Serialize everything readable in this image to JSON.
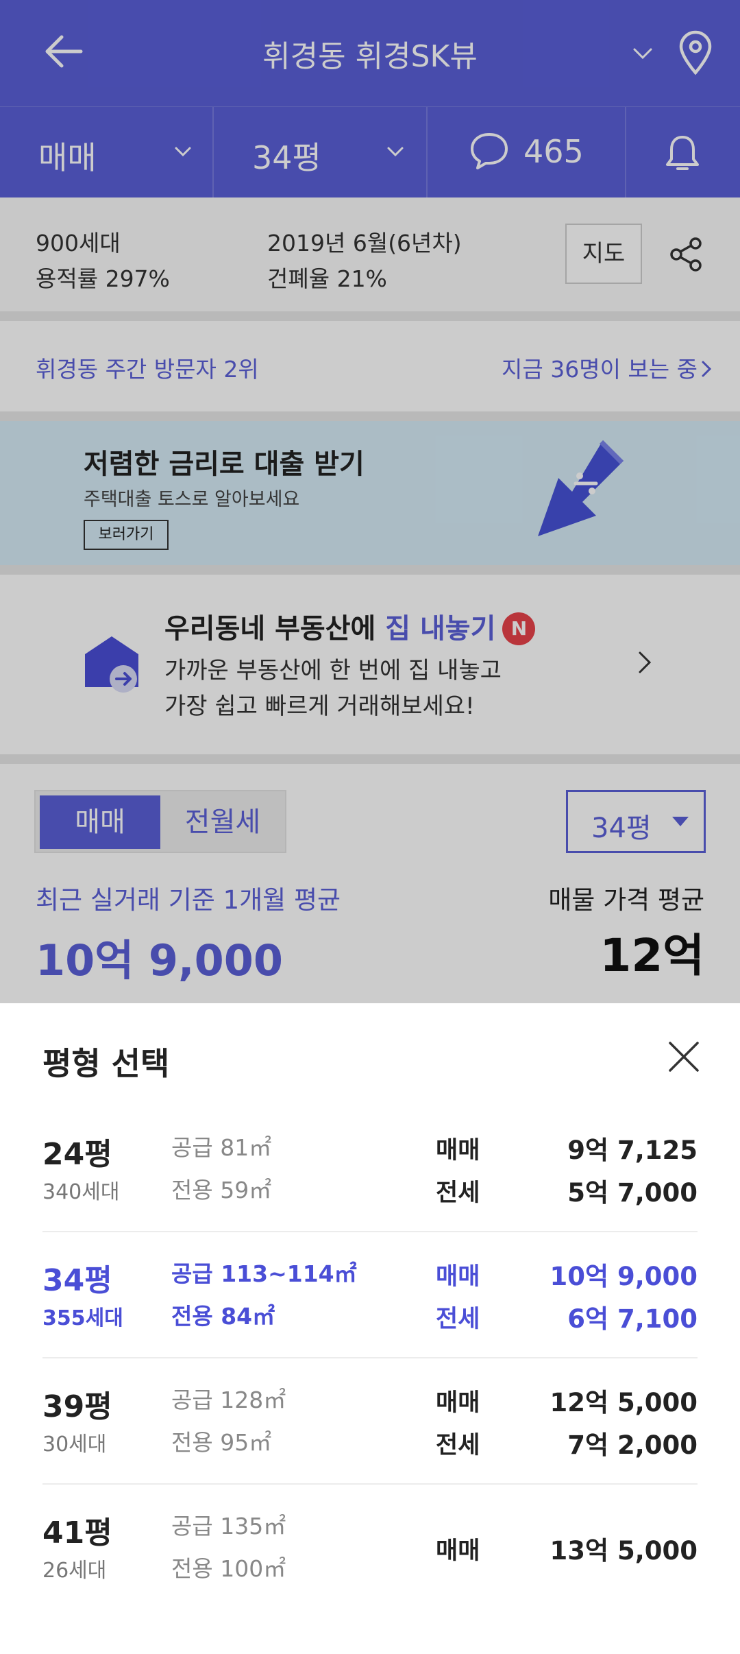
{
  "header": {
    "title": "휘경동 휘경SK뷰"
  },
  "tabs": {
    "deal_type": "매매",
    "size": "34평",
    "comments": "465"
  },
  "info": {
    "households": "900세대",
    "floor_area_ratio": "용적률 297%",
    "built": "2019년 6월(6년차)",
    "coverage_ratio": "건폐율 21%",
    "map_button": "지도"
  },
  "visitors": {
    "rank": "휘경동 주간 방문자 2위",
    "viewing_now": "지금 36명이 보는 중"
  },
  "loan_banner": {
    "title": "저렴한 금리로 대출 받기",
    "subtitle": "주택대출 토스로 알아보세요",
    "button": "보러가기"
  },
  "listing_promo": {
    "title_prefix": "우리동네 부동산에 ",
    "title_highlight": "집 내놓기",
    "badge": "N",
    "line1": "가까운 부동산에 한 번에 집 내놓고",
    "line2": "가장 쉽고 빠르게 거래해보세요!"
  },
  "price_section": {
    "toggle_active": "매매",
    "toggle_inactive": "전월세",
    "size_select": "34평",
    "recent_label": "최근 실거래 기준 1개월 평균",
    "recent_value": "10억 9,000",
    "listing_label": "매물 가격 평균",
    "listing_value": "12억"
  },
  "sheet": {
    "title": "평형 선택",
    "rows": [
      {
        "pyeong": "24평",
        "households": "340세대",
        "supply": "공급 81㎡",
        "exclusive": "전용 59㎡",
        "type1": "매매",
        "price1": "9억 7,125",
        "type2": "전세",
        "price2": "5억 7,000"
      },
      {
        "pyeong": "34평",
        "households": "355세대",
        "supply": "공급 113~114㎡",
        "exclusive": "전용 84㎡",
        "type1": "매매",
        "price1": "10억 9,000",
        "type2": "전세",
        "price2": "6억 7,100"
      },
      {
        "pyeong": "39평",
        "households": "30세대",
        "supply": "공급 128㎡",
        "exclusive": "전용 95㎡",
        "type1": "매매",
        "price1": "12억 5,000",
        "type2": "전세",
        "price2": "7억 2,000"
      },
      {
        "pyeong": "41평",
        "households": "26세대",
        "supply": "공급 135㎡",
        "exclusive": "전용 100㎡",
        "type1": "매매",
        "price1": "13억 5,000"
      }
    ]
  },
  "colors": {
    "brand": "#5a5fd8",
    "selected": "#4a4ed6",
    "badge": "#e8434a",
    "banner_bg": "#d6ecf7"
  }
}
